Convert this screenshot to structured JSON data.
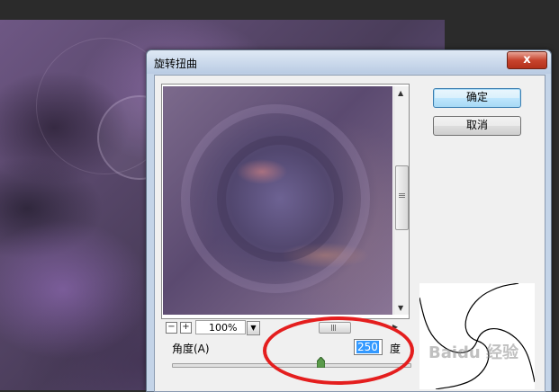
{
  "dialog": {
    "title": "旋转扭曲",
    "close_label": "x",
    "ok_label": "确定",
    "cancel_label": "取消"
  },
  "preview": {
    "zoom_value": "100%",
    "zoom_out": "−",
    "zoom_in": "+"
  },
  "angle": {
    "label": "角度(A)",
    "value": "250",
    "unit": "度",
    "slider_fraction": 0.625
  },
  "watermark": "Baidu 经验",
  "colors": {
    "annotation": "#e41e1e",
    "default_button": "#3c7fb1",
    "selection": "#3399ff"
  }
}
